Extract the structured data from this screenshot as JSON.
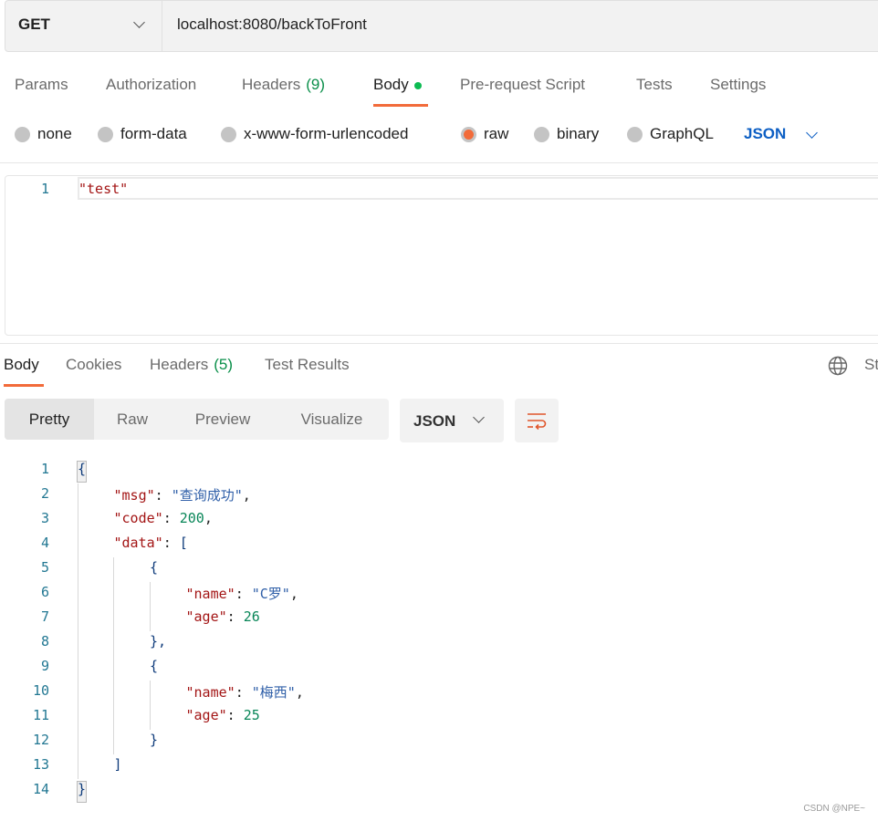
{
  "request": {
    "method": "GET",
    "url": "localhost:8080/backToFront"
  },
  "request_tabs": [
    {
      "label": "Params"
    },
    {
      "label": "Authorization"
    },
    {
      "label": "Headers",
      "count": "(9)"
    },
    {
      "label": "Body",
      "active": true
    },
    {
      "label": "Pre-request Script"
    },
    {
      "label": "Tests"
    },
    {
      "label": "Settings"
    }
  ],
  "body_types": [
    "none",
    "form-data",
    "x-www-form-urlencoded",
    "raw",
    "binary",
    "GraphQL"
  ],
  "selected_body_type": "raw",
  "body_language": "JSON",
  "request_body": {
    "line_number": "1",
    "text": "\"test\""
  },
  "response_tabs": [
    {
      "label": "Body",
      "active": true
    },
    {
      "label": "Cookies"
    },
    {
      "label": "Headers",
      "count": "(5)"
    },
    {
      "label": "Test Results"
    }
  ],
  "status_partial": "St",
  "view_modes": [
    "Pretty",
    "Raw",
    "Preview",
    "Visualize"
  ],
  "response_format": "JSON",
  "response_lines": [
    [
      0,
      [
        [
          "brk",
          "{"
        ]
      ]
    ],
    [
      1,
      [
        [
          "key",
          "\"msg\""
        ],
        [
          "pun",
          ": "
        ],
        [
          "str",
          "\"查询成功\""
        ],
        [
          "pun",
          ","
        ]
      ]
    ],
    [
      1,
      [
        [
          "key",
          "\"code\""
        ],
        [
          "pun",
          ": "
        ],
        [
          "num",
          "200"
        ],
        [
          "pun",
          ","
        ]
      ]
    ],
    [
      1,
      [
        [
          "key",
          "\"data\""
        ],
        [
          "pun",
          ": "
        ],
        [
          "brk",
          "["
        ]
      ]
    ],
    [
      2,
      [
        [
          "brk",
          "{"
        ]
      ]
    ],
    [
      3,
      [
        [
          "key",
          "\"name\""
        ],
        [
          "pun",
          ": "
        ],
        [
          "str",
          "\"C罗\""
        ],
        [
          "pun",
          ","
        ]
      ]
    ],
    [
      3,
      [
        [
          "key",
          "\"age\""
        ],
        [
          "pun",
          ": "
        ],
        [
          "num",
          "26"
        ]
      ]
    ],
    [
      2,
      [
        [
          "brk",
          "},"
        ]
      ]
    ],
    [
      2,
      [
        [
          "brk",
          "{"
        ]
      ]
    ],
    [
      3,
      [
        [
          "key",
          "\"name\""
        ],
        [
          "pun",
          ": "
        ],
        [
          "str",
          "\"梅西\""
        ],
        [
          "pun",
          ","
        ]
      ]
    ],
    [
      3,
      [
        [
          "key",
          "\"age\""
        ],
        [
          "pun",
          ": "
        ],
        [
          "num",
          "25"
        ]
      ]
    ],
    [
      2,
      [
        [
          "brk",
          "}"
        ]
      ]
    ],
    [
      1,
      [
        [
          "brk",
          "]"
        ]
      ]
    ],
    [
      0,
      [
        [
          "brk",
          "}"
        ]
      ]
    ]
  ],
  "watermark": "CSDN @NPE~",
  "colors": {
    "accent": "#f26b3a",
    "link": "#0d5fc4",
    "count": "#0a8f4a"
  }
}
